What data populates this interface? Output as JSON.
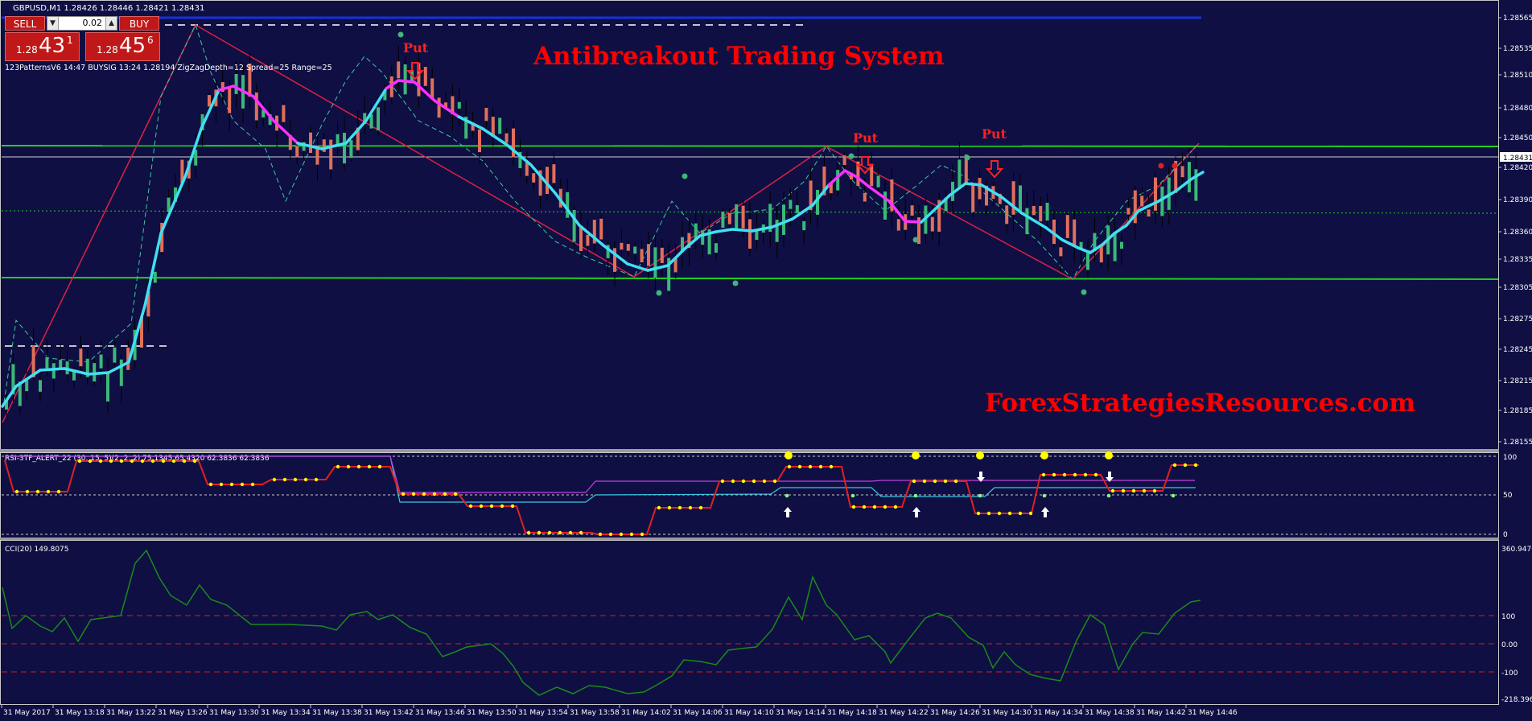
{
  "symbol_header": "GBPUSD,M1  1.28426 1.28446 1.28421 1.28431",
  "indicator_header": "123PatternsV6  14:47  BUYSIG  13:24  1.28194  ZigZagDepth=12  Spread=25  Range=25",
  "trade_panel": {
    "sell_label": "SELL",
    "buy_label": "BUY",
    "lot": "0.02",
    "sell_price": {
      "prefix": "1.28",
      "big": "43",
      "sup": "1"
    },
    "buy_price": {
      "prefix": "1.28",
      "big": "45",
      "sup": "6"
    }
  },
  "overlay_titles": {
    "title": "Antibreakout Trading System",
    "watermark": "ForexStrategiesResources.com"
  },
  "put_labels": [
    "Put",
    "Put",
    "Put"
  ],
  "price_axis": {
    "labels": [
      "1.28565",
      "1.28535",
      "1.28510",
      "1.28480",
      "1.28450",
      "1.28420",
      "1.28390",
      "1.28360",
      "1.28335",
      "1.28305",
      "1.28275",
      "1.28245",
      "1.28215",
      "1.28185",
      "1.28155"
    ],
    "current_price": "1.28431"
  },
  "time_axis": [
    "31 May 2017",
    "31 May 13:18",
    "31 May 13:22",
    "31 May 13:26",
    "31 May 13:30",
    "31 May 13:34",
    "31 May 13:38",
    "31 May 13:42",
    "31 May 13:46",
    "31 May 13:50",
    "31 May 13:54",
    "31 May 13:58",
    "31 May 14:02",
    "31 May 14:06",
    "31 May 14:10",
    "31 May 14:14",
    "31 May 14:18",
    "31 May 14:22",
    "31 May 14:26",
    "31 May 14:30",
    "31 May 14:34",
    "31 May 14:38",
    "31 May 14:42",
    "31 May 14:46"
  ],
  "rsi_panel": {
    "header": "RSI-3TF_ALERT_22 (30, 15, 5)(2, 2, 2)  75.1345 65.4320 62.3836 62.3836",
    "axis_labels": [
      "100",
      "50",
      "0"
    ]
  },
  "cci_panel": {
    "header": "CCI(20) 149.8075",
    "axis_labels": [
      "360.9476",
      "100",
      "0.00",
      "-100",
      "-218.3967"
    ]
  },
  "colors": {
    "background": "#0f0f44",
    "bull": "#3cb878",
    "bear": "#e0705a",
    "ma_up": "#40e0f0",
    "ma_down": "#ff30ff",
    "zigzag": "#e02040",
    "level_line": "#20d020",
    "title_red": "#ff0000"
  }
}
